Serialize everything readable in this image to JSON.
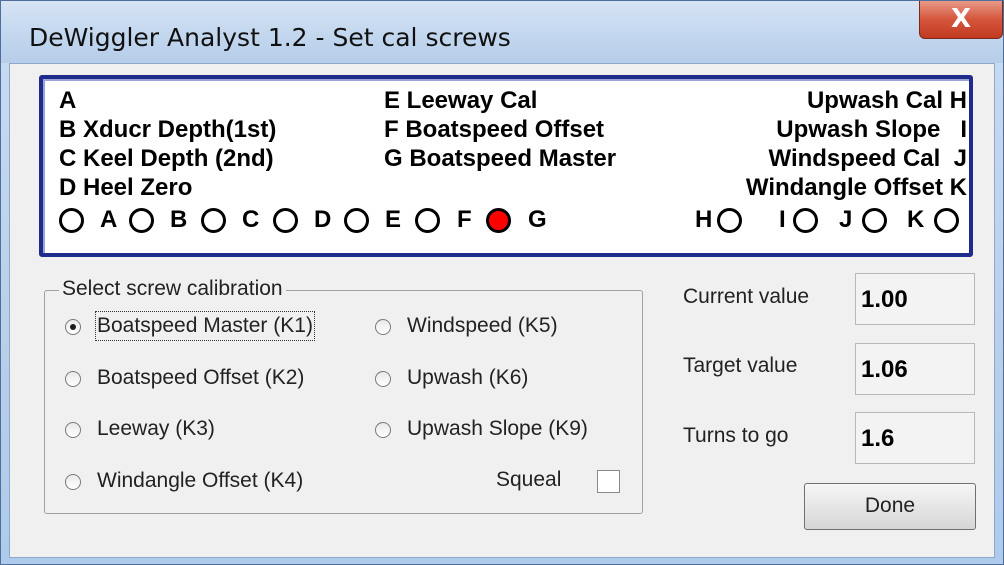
{
  "window": {
    "title": "DeWiggler Analyst 1.2 - Set cal screws",
    "close_glyph": "X"
  },
  "legend": {
    "left": [
      "A",
      "B Xducr Depth(1st)",
      "C Keel Depth (2nd)",
      "D Heel Zero"
    ],
    "middle": [
      "E Leeway Cal",
      "F Boatspeed Offset",
      "G Boatspeed Master"
    ],
    "right": [
      "Upwash Cal H",
      "Upwash Slope   I",
      "Windspeed Cal  J",
      "Windangle Offset K"
    ],
    "screw_labels": [
      "A",
      "B",
      "C",
      "D",
      "E",
      "F",
      "G",
      "H",
      "I",
      "J",
      "K"
    ],
    "active_screw": "G",
    "active_color": "#ff0000"
  },
  "calibration": {
    "group_title": "Select screw calibration",
    "options": [
      {
        "label": "Boatspeed Master (K1)",
        "selected": true
      },
      {
        "label": "Boatspeed Offset (K2)",
        "selected": false
      },
      {
        "label": "Leeway (K3)",
        "selected": false
      },
      {
        "label": "Windangle Offset (K4)",
        "selected": false
      },
      {
        "label": "Windspeed (K5)",
        "selected": false
      },
      {
        "label": "Upwash (K6)",
        "selected": false
      },
      {
        "label": "Upwash Slope (K9)",
        "selected": false
      }
    ],
    "squeal_label": "Squeal",
    "squeal_checked": false
  },
  "values": {
    "current_label": "Current value",
    "current_value": "1.00",
    "target_label": "Target value",
    "target_value": "1.06",
    "turns_label": "Turns to go",
    "turns_value": "1.6"
  },
  "buttons": {
    "done": "Done"
  }
}
